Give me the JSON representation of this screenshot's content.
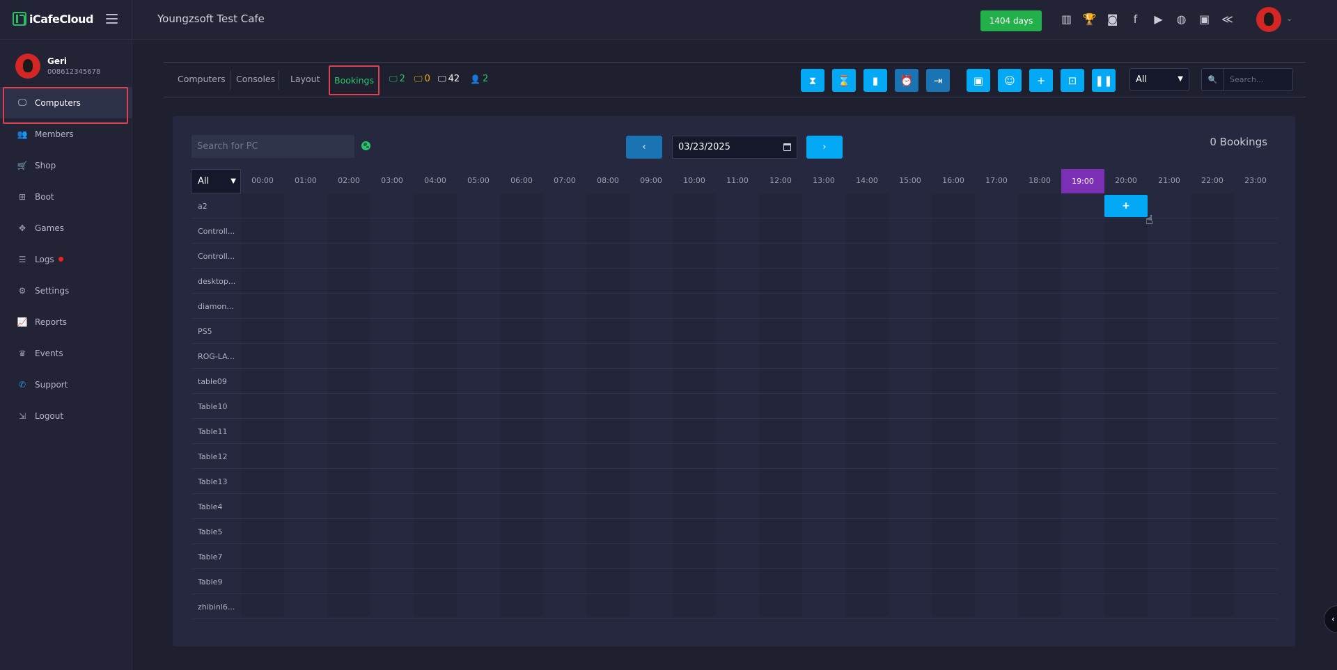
{
  "app": {
    "logo_text": "iCafeCloud",
    "cafe_name": "Youngzsoft Test Cafe",
    "days_badge": "1404 days"
  },
  "top_icons": [
    "ranking-icon",
    "trophy-icon",
    "discord-icon",
    "facebook-icon",
    "youtube-icon",
    "globe-icon",
    "icafe-icon",
    "double-chevron-icon"
  ],
  "user": {
    "name": "Geri",
    "phone": "008612345678"
  },
  "sidebar": {
    "items": [
      {
        "label": "Computers",
        "icon": "monitor-icon",
        "active": true
      },
      {
        "label": "Members",
        "icon": "users-icon"
      },
      {
        "label": "Shop",
        "icon": "cart-icon"
      },
      {
        "label": "Boot",
        "icon": "windows-icon"
      },
      {
        "label": "Games",
        "icon": "gamepad-icon"
      },
      {
        "label": "Logs",
        "icon": "list-icon",
        "dot": true
      },
      {
        "label": "Settings",
        "icon": "gear-icon"
      },
      {
        "label": "Reports",
        "icon": "chart-icon"
      },
      {
        "label": "Events",
        "icon": "crown-icon"
      },
      {
        "label": "Support",
        "icon": "phone-icon"
      },
      {
        "label": "Logout",
        "icon": "logout-icon"
      }
    ]
  },
  "tabs": {
    "computers": "Computers",
    "consoles": "Consoles",
    "layout": "Layout",
    "bookings": "Bookings"
  },
  "stats": {
    "online": "2",
    "warning": "0",
    "total": "42",
    "members": "2"
  },
  "colors": {
    "online": "#2cc46a",
    "warning": "#f5b400",
    "total": "#ffffff",
    "members": "#2cc46a",
    "accent": "#03a9f4",
    "current_hour": "#7b2fb5"
  },
  "toolbar_icons": [
    "hourglass-full-icon",
    "hourglass-icon",
    "battery-icon",
    "alarm-icon",
    "exit-icon",
    "cash-icon",
    "user-check-icon",
    "user-plus-icon",
    "screen-icon",
    "pause-icon"
  ],
  "filter": {
    "selected": "All"
  },
  "top_search": {
    "placeholder": "Search..."
  },
  "booking": {
    "search_placeholder": "Search for PC",
    "date": "03/23/2025",
    "prev_label": "‹",
    "next_label": "›",
    "count_label": "0 Bookings",
    "group_select": "All",
    "add_label": "+",
    "hours": [
      "00:00",
      "01:00",
      "02:00",
      "03:00",
      "04:00",
      "05:00",
      "06:00",
      "07:00",
      "08:00",
      "09:00",
      "10:00",
      "11:00",
      "12:00",
      "13:00",
      "14:00",
      "15:00",
      "16:00",
      "17:00",
      "18:00",
      "19:00",
      "20:00",
      "21:00",
      "22:00",
      "23:00"
    ],
    "current_hour": "19:00",
    "pcs": [
      "a2",
      "Controll...",
      "Controll...",
      "desktop...",
      "diamon...",
      "PS5",
      "ROG-LA...",
      "table09",
      "Table10",
      "Table11",
      "Table12",
      "Table13",
      "Table4",
      "Table5",
      "Table7",
      "Table9",
      "zhibinl6..."
    ]
  }
}
